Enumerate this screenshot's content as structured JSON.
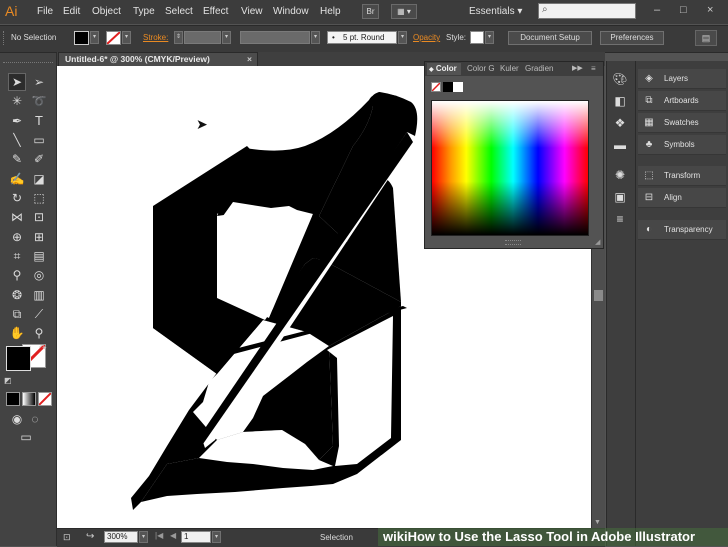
{
  "app": {
    "logo": "Ai"
  },
  "menubar": {
    "items": [
      "File",
      "Edit",
      "Object",
      "Type",
      "Select",
      "Effect",
      "View",
      "Window",
      "Help"
    ],
    "bridge_button": "Br",
    "workspace": "Essentials",
    "window_controls": [
      "–",
      "□",
      "×"
    ]
  },
  "controlbar": {
    "selection_status": "No Selection",
    "stroke_label": "Stroke:",
    "brush_label": "5 pt. Round",
    "opacity_label": "Opacity",
    "style_label": "Style:",
    "document_setup": "Document Setup",
    "preferences": "Preferences"
  },
  "document": {
    "tab_title": "Untitled-6* @ 300% (CMYK/Preview)",
    "close_glyph": "×"
  },
  "statusbar": {
    "zoom": "300%",
    "artboard_number": "1",
    "status": "Selection"
  },
  "color_panel": {
    "tabs": [
      "Color",
      "Color G",
      "Kuler",
      "Gradien"
    ],
    "menu_glyph": "≡"
  },
  "panels": [
    "Layers",
    "Artboards",
    "Swatches",
    "Symbols",
    "Transform",
    "Align",
    "Transparency"
  ],
  "colors": {
    "accent": "#e98a23",
    "fill": "#000000",
    "canvas": "#ffffff",
    "ui_dark": "#535353"
  },
  "watermark": "wikiHow to Use the Lasso Tool in Adobe Illustrator"
}
